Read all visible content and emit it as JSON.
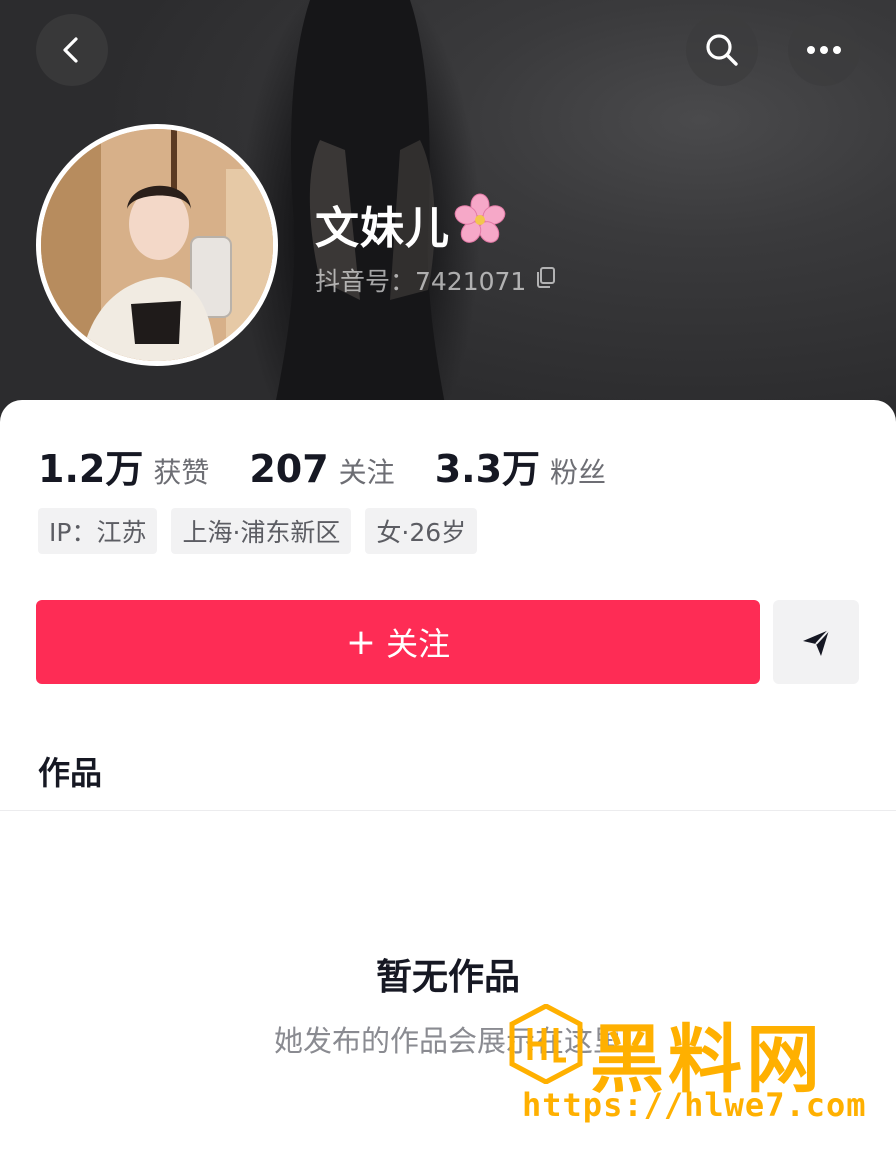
{
  "profile": {
    "nickname": "文妹儿",
    "nickname_emoji": "🌸",
    "account_id": "抖音号：7421071"
  },
  "top_bar": {
    "back_icon": "chevron-left-icon",
    "search_icon": "search-icon",
    "more_icon": "more-horizontal-icon"
  },
  "stats": [
    {
      "value": "1.2万",
      "label": "获赞"
    },
    {
      "value": "207",
      "label": "关注"
    },
    {
      "value": "3.3万",
      "label": "粉丝"
    }
  ],
  "tags": [
    "IP：江苏",
    "上海·浦东新区",
    "女·26岁"
  ],
  "actions": {
    "follow_plus": "+",
    "follow_label": "关注",
    "send_icon": "send-icon"
  },
  "tabs": {
    "works": "作品"
  },
  "empty_state": {
    "title": "暂无作品",
    "subtitle": "她发布的作品会展示在这里"
  },
  "watermark": {
    "text": "黑料网",
    "url": "https://hlwe7.com"
  },
  "colors": {
    "accent": "#fe2c55",
    "watermark": "#ffb000"
  }
}
